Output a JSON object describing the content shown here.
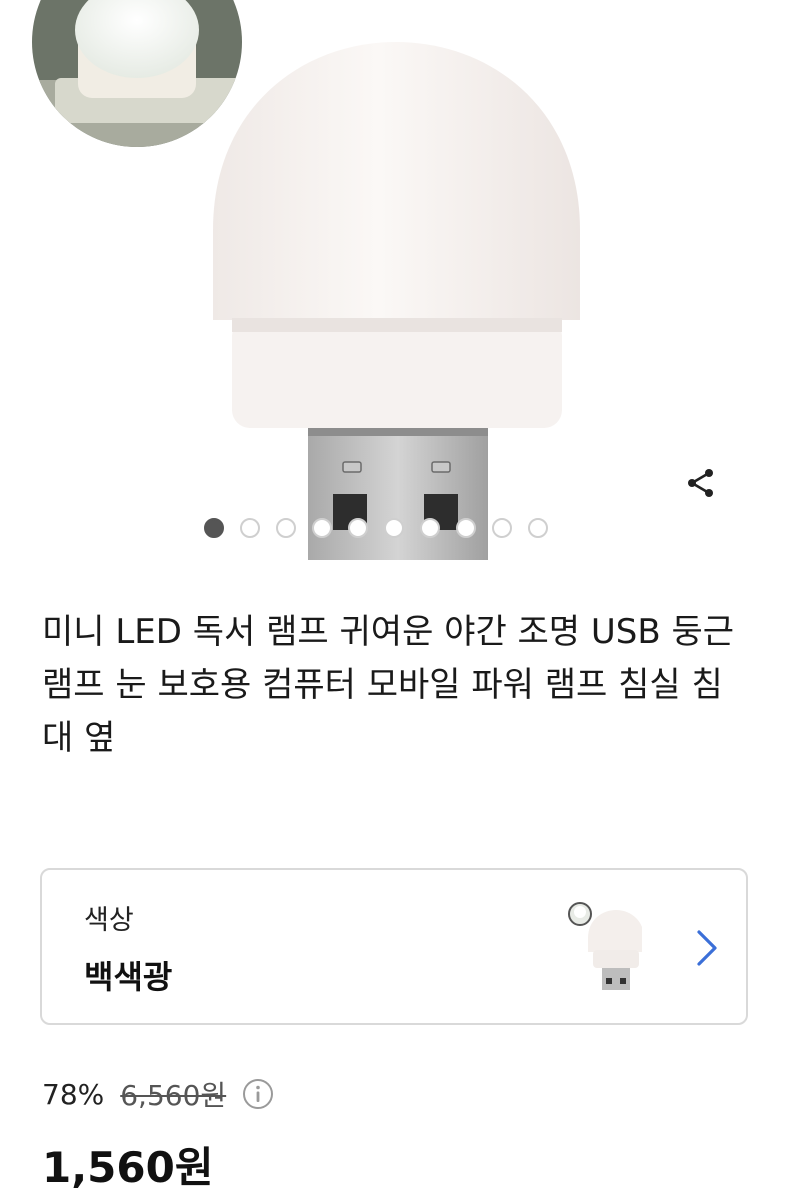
{
  "gallery": {
    "image_count": 10,
    "active_index": 0,
    "share_icon": "share-icon"
  },
  "product": {
    "title": "미니 LED 독서 램프 귀여운 야간 조명 USB 둥근 램프 눈 보호용 컴퓨터 모바일 파워 램프 침실 침대 옆"
  },
  "option": {
    "label": "색상",
    "value": "백색광",
    "chevron_icon": "chevron-right-icon"
  },
  "price": {
    "discount": "78%",
    "original": "6,560원",
    "final": "1,560원",
    "info_icon": "info-icon"
  },
  "colors": {
    "chevron": "#3b6fd8",
    "dot_active": "#555555",
    "dot_inactive_border": "#cfcfcf"
  }
}
